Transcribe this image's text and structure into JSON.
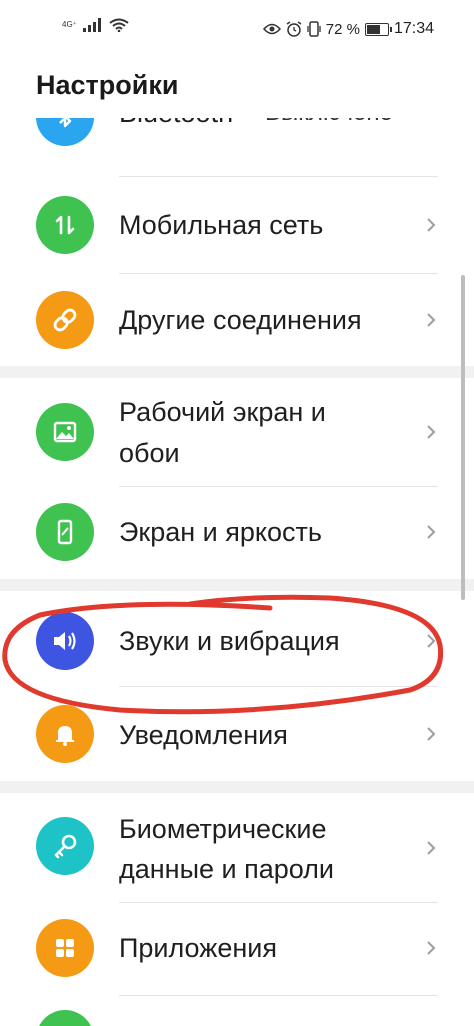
{
  "status_bar": {
    "network": "4G⁺",
    "battery_percent": "72 %",
    "battery_level": 0.72,
    "time": "17:34"
  },
  "page_title": "Настройки",
  "items": [
    {
      "label": "Bluetooth",
      "secondary": "Выключено",
      "icon": "bluetooth-icon",
      "color": "#2aa6f0"
    },
    {
      "label": "Мобильная сеть",
      "icon": "mobile-data-icon",
      "color": "#3fc24f"
    },
    {
      "label": "Другие соединения",
      "icon": "link-icon",
      "color": "#f59a14"
    },
    {
      "label_line1": "Рабочий экран и",
      "label_line2": "обои",
      "icon": "image-icon",
      "color": "#3fc24f"
    },
    {
      "label": "Экран и яркость",
      "icon": "phone-icon",
      "color": "#3fc24f"
    },
    {
      "label": "Звуки и вибрация",
      "icon": "speaker-icon",
      "color": "#3d55e0"
    },
    {
      "label": "Уведомления",
      "icon": "bell-icon",
      "color": "#f59a14"
    },
    {
      "label_line1": "Биометрические",
      "label_line2": "данные и пароли",
      "icon": "key-icon",
      "color": "#1ec3c8"
    },
    {
      "label": "Приложения",
      "icon": "apps-icon",
      "color": "#f59a14"
    }
  ],
  "annotation_color": "#e03a2f"
}
